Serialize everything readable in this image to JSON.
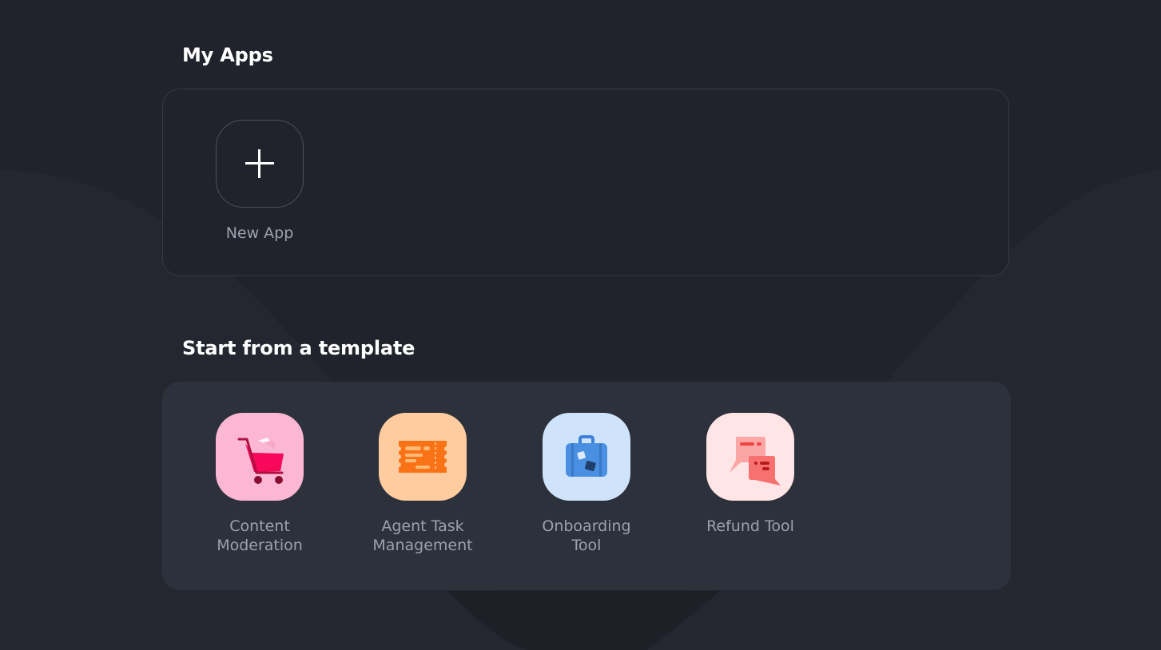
{
  "my_apps": {
    "title": "My Apps",
    "new_app_label": "New App"
  },
  "templates": {
    "title": "Start from a template",
    "items": [
      {
        "label": "Content\nModeration",
        "icon": "shopping-cart-icon",
        "bg": "#fbb7d3"
      },
      {
        "label": "Agent Task\nManagement",
        "icon": "ticket-icon",
        "bg": "#ffcca0"
      },
      {
        "label": "Onboarding\nTool",
        "icon": "suitcase-icon",
        "bg": "#cfe4fb"
      },
      {
        "label": "Refund Tool",
        "icon": "chat-bubbles-icon",
        "bg": "#ffe5e5"
      }
    ]
  },
  "colors": {
    "background": "#20232b",
    "panel": "#2d313b",
    "title": "#ffffff",
    "label": "#9ca1ad"
  }
}
